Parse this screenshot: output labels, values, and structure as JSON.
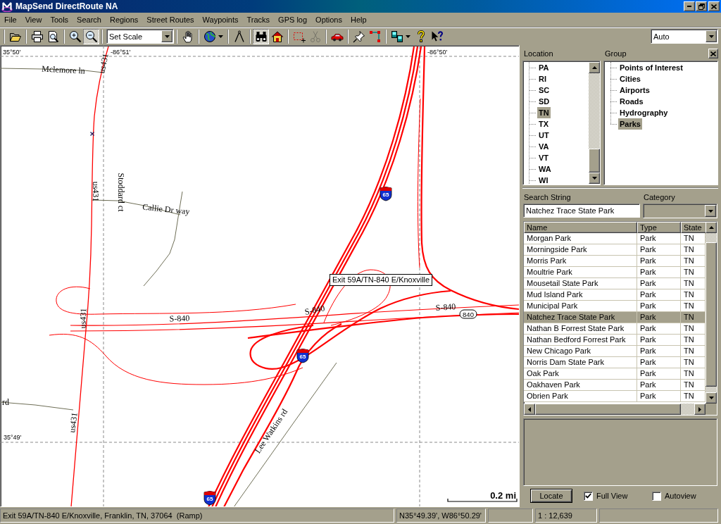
{
  "window": {
    "title": "MapSend DirectRoute NA"
  },
  "menu": [
    "File",
    "View",
    "Tools",
    "Search",
    "Regions",
    "Street Routes",
    "Waypoints",
    "Tracks",
    "GPS log",
    "Options",
    "Help"
  ],
  "toolbar": {
    "buttons": [
      {
        "kind": "button",
        "pressed": false,
        "disabled": false
      },
      {
        "kind": "button",
        "pressed": false,
        "disabled": false
      },
      {
        "kind": "button",
        "pressed": false,
        "disabled": false
      },
      {
        "kind": "button",
        "pressed": false,
        "disabled": false
      },
      {
        "kind": "button",
        "pressed": true,
        "disabled": false
      },
      {
        "kind": "button",
        "pressed": false,
        "disabled": false
      },
      {
        "kind": "menu_button",
        "pressed": false,
        "disabled": false
      },
      {
        "kind": "button",
        "pressed": false,
        "disabled": false
      },
      {
        "kind": "button",
        "pressed": true,
        "disabled": false
      },
      {
        "kind": "button",
        "pressed": false,
        "disabled": false
      },
      {
        "kind": "button",
        "pressed": false,
        "disabled": false
      },
      {
        "kind": "button",
        "pressed": false,
        "disabled": true
      },
      {
        "kind": "button",
        "pressed": false,
        "disabled": false
      },
      {
        "kind": "button",
        "pressed": false,
        "disabled": false
      },
      {
        "kind": "button",
        "pressed": false,
        "disabled": false
      },
      {
        "kind": "menu_button",
        "pressed": false,
        "disabled": false
      },
      {
        "kind": "button",
        "pressed": false,
        "disabled": false
      },
      {
        "kind": "button",
        "pressed": false,
        "disabled": false
      }
    ],
    "scale_combo": {
      "value": "Set Scale"
    },
    "zoom_combo": {
      "value": "Auto"
    }
  },
  "map": {
    "grid_labels": [
      "35°50'",
      "-86°51'",
      "-86°50'",
      "35°49'"
    ],
    "road_labels": [
      "Mclemore ln",
      "us431",
      "us431",
      "Stoddard ct",
      "Callie Dr way",
      "S-840",
      "S-840",
      "S-840",
      "us431",
      "rd",
      "us431",
      "Lee Watkins rd"
    ],
    "shields": [
      {
        "kind": "interstate",
        "text": "65"
      },
      {
        "kind": "state",
        "text": "840"
      },
      {
        "kind": "interstate",
        "text": "65"
      },
      {
        "kind": "interstate",
        "text": "65"
      }
    ],
    "tooltip": "Exit 59A/TN-840 E/Knoxville",
    "scale": "0.2 mi"
  },
  "panel": {
    "location": {
      "label": "Location",
      "items": [
        {
          "text": "PA",
          "selected": false
        },
        {
          "text": "RI",
          "selected": false
        },
        {
          "text": "SC",
          "selected": false
        },
        {
          "text": "SD",
          "selected": false
        },
        {
          "text": "TN",
          "selected": true
        },
        {
          "text": "TX",
          "selected": false
        },
        {
          "text": "UT",
          "selected": false
        },
        {
          "text": "VA",
          "selected": false
        },
        {
          "text": "VT",
          "selected": false
        },
        {
          "text": "WA",
          "selected": false
        },
        {
          "text": "WI",
          "selected": false
        }
      ]
    },
    "group": {
      "label": "Group",
      "items": [
        {
          "text": "Points of Interest",
          "selected": false
        },
        {
          "text": "Cities",
          "selected": false
        },
        {
          "text": "Airports",
          "selected": false
        },
        {
          "text": "Roads",
          "selected": false
        },
        {
          "text": "Hydrography",
          "selected": false
        },
        {
          "text": "Parks",
          "selected": true
        }
      ]
    },
    "search": {
      "label": "Search String",
      "value": "Natchez Trace State Park"
    },
    "category": {
      "label": "Category",
      "disabled": true
    },
    "results": {
      "columns": [
        "Name",
        "Type",
        "State"
      ],
      "rows": [
        {
          "cells": [
            "Morgan Park",
            "Park",
            "TN"
          ],
          "selected": false
        },
        {
          "cells": [
            "Morningside Park",
            "Park",
            "TN"
          ],
          "selected": false
        },
        {
          "cells": [
            "Morris Park",
            "Park",
            "TN"
          ],
          "selected": false
        },
        {
          "cells": [
            "Moultrie Park",
            "Park",
            "TN"
          ],
          "selected": false
        },
        {
          "cells": [
            "Mousetail State Park",
            "Park",
            "TN"
          ],
          "selected": false
        },
        {
          "cells": [
            "Mud Island Park",
            "Park",
            "TN"
          ],
          "selected": false
        },
        {
          "cells": [
            "Municipal Park",
            "Park",
            "TN"
          ],
          "selected": false
        },
        {
          "cells": [
            "Natchez Trace State Park",
            "Park",
            "TN"
          ],
          "selected": true
        },
        {
          "cells": [
            "Nathan B Forrest State Park",
            "Park",
            "TN"
          ],
          "selected": false
        },
        {
          "cells": [
            "Nathan Bedford Forrest Park",
            "Park",
            "TN"
          ],
          "selected": false
        },
        {
          "cells": [
            "New Chicago Park",
            "Park",
            "TN"
          ],
          "selected": false
        },
        {
          "cells": [
            "Norris Dam State Park",
            "Park",
            "TN"
          ],
          "selected": false
        },
        {
          "cells": [
            "Oak Park",
            "Park",
            "TN"
          ],
          "selected": false
        },
        {
          "cells": [
            "Oakhaven Park",
            "Park",
            "TN"
          ],
          "selected": false
        },
        {
          "cells": [
            "Obrien Park",
            "Park",
            "TN"
          ],
          "selected": false
        }
      ]
    },
    "locate_button": "Locate",
    "options": [
      {
        "label": "Full View",
        "checked": true
      },
      {
        "label": "Autoview",
        "checked": false
      }
    ]
  },
  "status_bar": {
    "address": "Exit 59A/TN-840 E/Knoxville, Franklin, TN, 37064  (Ramp)",
    "coordinates": "N35°49.39', W86°50.29'",
    "scale": "1 : 12,639"
  }
}
